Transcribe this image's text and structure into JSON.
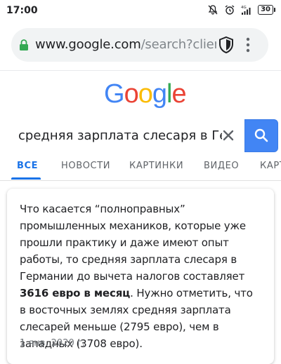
{
  "status_bar": {
    "time": "17:00",
    "battery": "30",
    "network": "4G"
  },
  "browser": {
    "url_host": "www.google.com",
    "url_path": "/search?client"
  },
  "logo": {
    "letters": [
      "G",
      "o",
      "o",
      "g",
      "l",
      "e"
    ],
    "colors": [
      "#4285f4",
      "#ea4335",
      "#fbbc05",
      "#4285f4",
      "#34a853",
      "#ea4335"
    ]
  },
  "search": {
    "query": "средняя зарплата слесаря в Германии"
  },
  "tabs": [
    {
      "label": "ВСЕ",
      "active": true
    },
    {
      "label": "НОВОСТИ",
      "active": false
    },
    {
      "label": "КАРТИНКИ",
      "active": false
    },
    {
      "label": "ВИДЕО",
      "active": false
    },
    {
      "label": "КАРТЫ",
      "active": false
    }
  ],
  "snippet": {
    "text_before": "Что касается “полноправных” промышленных механиков, которые уже прошли практику и даже имеют опыт работы, то средняя зарплата слесаря в Германии до вычета налогов составляет ",
    "highlight": "3616 евро в месяц",
    "text_after": ". Нужно отметить, что в восточных землях средняя зарплата слесарей меньше (2795 евро), чем в западных (3708 евро).",
    "date": "1 янв. 2020 г."
  },
  "colors": {
    "accent": "#1a73e8",
    "search_button": "#4285f4"
  }
}
